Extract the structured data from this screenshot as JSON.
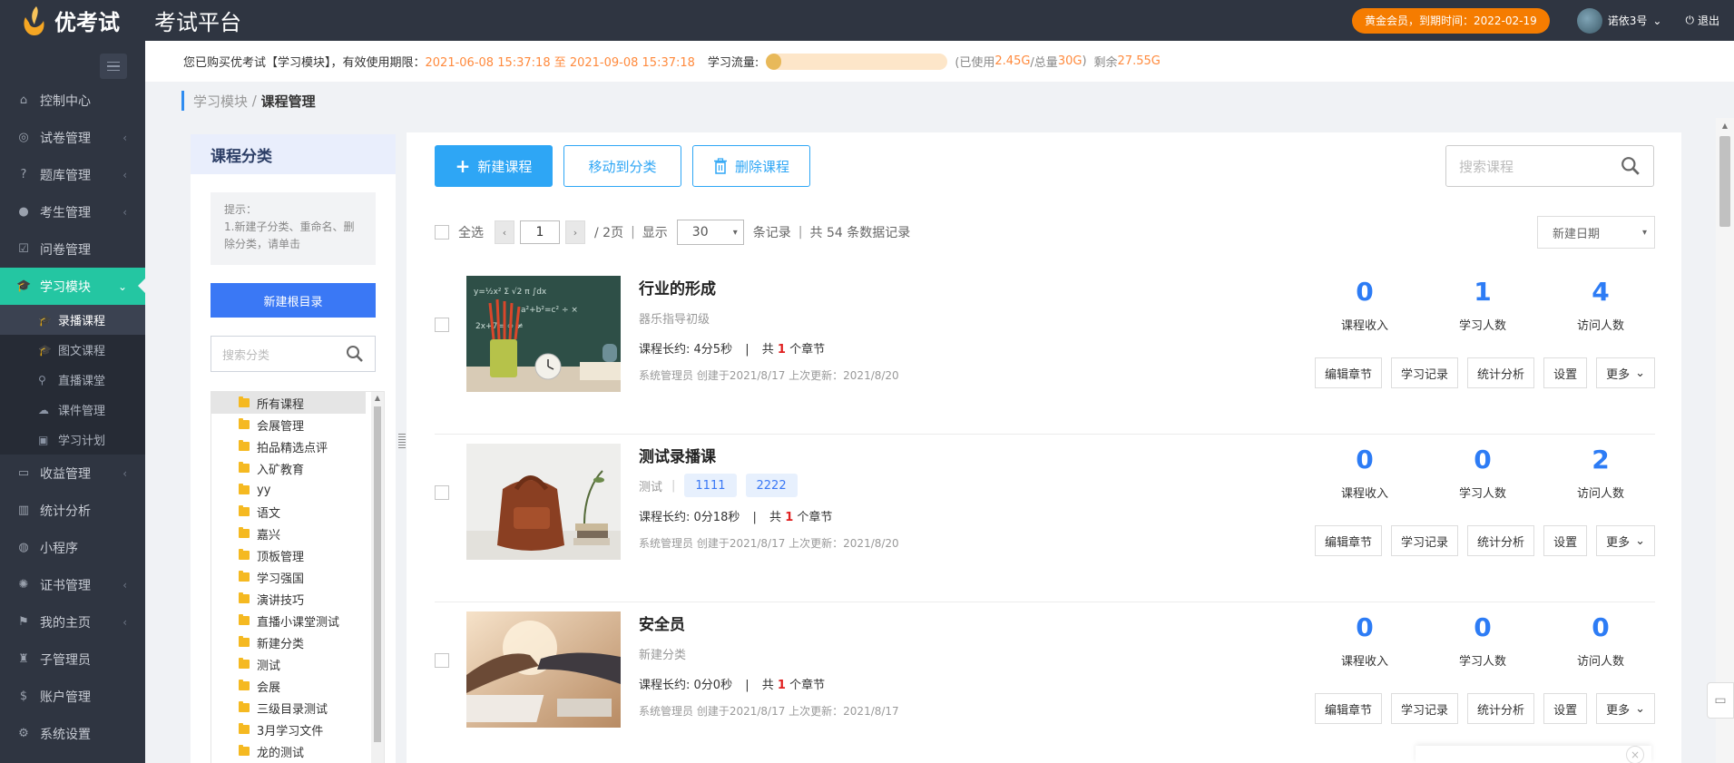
{
  "header": {
    "logo_text": "优考试",
    "platform_title": "考试平台",
    "vip_badge": "黄金会员，到期时间：2022-02-19",
    "username": "诺依3号",
    "logout": "退出"
  },
  "sidebar": {
    "items": [
      {
        "label": "控制中心",
        "icon": "home-icon"
      },
      {
        "label": "试卷管理",
        "icon": "check-circle-icon"
      },
      {
        "label": "题库管理",
        "icon": "question-circle-icon"
      },
      {
        "label": "考生管理",
        "icon": "user-icon"
      },
      {
        "label": "问卷管理",
        "icon": "checkbox-icon"
      },
      {
        "label": "学习模块",
        "icon": "graduation-cap-icon"
      },
      {
        "label": "收益管理",
        "icon": "money-icon"
      },
      {
        "label": "统计分析",
        "icon": "bar-chart-icon"
      },
      {
        "label": "小程序",
        "icon": "wechat-icon"
      },
      {
        "label": "证书管理",
        "icon": "certificate-icon"
      },
      {
        "label": "我的主页",
        "icon": "flag-icon"
      },
      {
        "label": "子管理员",
        "icon": "user-lock-icon"
      },
      {
        "label": "账户管理",
        "icon": "dollar-icon"
      },
      {
        "label": "系统设置",
        "icon": "gear-icon"
      }
    ],
    "subitems": [
      {
        "label": "录播课程",
        "icon": "graduation-cap-icon"
      },
      {
        "label": "图文课程",
        "icon": "graduation-cap-icon"
      },
      {
        "label": "直播课堂",
        "icon": "broadcast-icon"
      },
      {
        "label": "课件管理",
        "icon": "cloud-icon"
      },
      {
        "label": "学习计划",
        "icon": "calendar-icon"
      }
    ]
  },
  "notice": {
    "prefix": "您已购买优考试【学习模块】，有效使用期限：",
    "period": "2021-06-08 15:37:18 至 2021-09-08 15:37:18",
    "traffic_label": "学习流量:",
    "used_prefix": "(已使用 ",
    "used": "2.45G",
    "total_prefix": "/总量 ",
    "total": "30G",
    "total_suffix": ")",
    "remain_prefix": "剩余 ",
    "remain": "27.55G",
    "usage_fraction": 0.082
  },
  "breadcrumb": {
    "parent": "学习模块",
    "separator": " / ",
    "current": "课程管理"
  },
  "category": {
    "title": "课程分类",
    "tip": "提示：\n1.新建子分类、重命名、删除分类，请单击",
    "new_root": "新建根目录",
    "search_placeholder": "搜索分类",
    "tree": [
      "所有课程",
      "会展管理",
      "拍品精选点评",
      "入矿教育",
      "yy",
      "语文",
      "嘉兴",
      "顶板管理",
      "学习强国",
      "演讲技巧",
      "直播小课堂测试",
      "新建分类",
      "测试",
      "会展",
      "三级目录测试",
      "3月学习文件",
      "龙的测试"
    ]
  },
  "toolbar": {
    "new_course": "新建课程",
    "move_to": "移动到分类",
    "delete": "删除课程",
    "search_placeholder": "搜索课程"
  },
  "listbar": {
    "select_all": "全选",
    "page": "1",
    "total_pages": "/ 2页",
    "show": "显示",
    "page_size": "30",
    "records": "条记录",
    "total_records": "共 54 条数据记录",
    "sort": "新建日期"
  },
  "courses": [
    {
      "title": "行业的形成",
      "category": "器乐指导初级",
      "tags": [],
      "duration": "4分5秒",
      "chapters": "1",
      "meta": "系统管理员 创建于2021/8/17 上次更新：2021/8/20",
      "income": "0",
      "learners": "1",
      "visitors": "4"
    },
    {
      "title": "测试录播课",
      "category": "测试",
      "tags": [
        "1111",
        "2222"
      ],
      "duration": "0分18秒",
      "chapters": "1",
      "meta": "系统管理员 创建于2021/8/17 上次更新：2021/8/20",
      "income": "0",
      "learners": "0",
      "visitors": "2"
    },
    {
      "title": "安全员",
      "category": "新建分类",
      "tags": [],
      "duration": "0分0秒",
      "chapters": "1",
      "meta": "系统管理员 创建于2021/8/17 上次更新：2021/8/17",
      "income": "0",
      "learners": "0",
      "visitors": "0"
    }
  ],
  "labels": {
    "duration_prefix": "课程长约:",
    "chapter_prefix": "共",
    "chapter_suffix": "个章节",
    "income": "课程收入",
    "learners": "学习人数",
    "visitors": "访问人数",
    "edit_chapter": "编辑章节",
    "records": "学习记录",
    "stats": "统计分析",
    "settings": "设置",
    "more": "更多"
  },
  "colors": {
    "accent": "#24c6a2",
    "primary": "#2ea6f5",
    "number_blue": "#2d7cf5",
    "orange": "#ff8a3d"
  }
}
